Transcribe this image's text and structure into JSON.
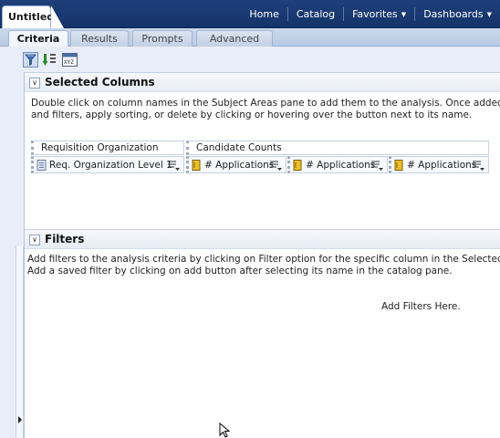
{
  "document_tab": {
    "title": "Untitled"
  },
  "nav": {
    "items": [
      {
        "label": "Home",
        "caret": false
      },
      {
        "label": "Catalog",
        "caret": false
      },
      {
        "label": "Favorites",
        "caret": true
      },
      {
        "label": "Dashboards",
        "caret": true
      }
    ]
  },
  "tabs": [
    {
      "label": "Criteria",
      "active": true
    },
    {
      "label": "Results",
      "active": false
    },
    {
      "label": "Prompts",
      "active": false
    },
    {
      "label": "Advanced",
      "active": false
    }
  ],
  "toolbar": {
    "buttons": [
      {
        "icon": "filter-icon",
        "active": true
      },
      {
        "icon": "sort-icon",
        "active": false
      },
      {
        "icon": "column-properties-icon",
        "active": false
      }
    ]
  },
  "selected_columns": {
    "title": "Selected Columns",
    "description_line1": "Double click on column names in the Subject Areas pane to add them to the analysis. Once added, drag-and-drop",
    "description_line2": "and filters, apply sorting, or delete by clicking or hovering over the button next to its name.",
    "groups": [
      {
        "header": "Requisition Organization",
        "columns": [
          {
            "label": "Req. Organization Level 1",
            "icon": "attribute-icon"
          }
        ]
      },
      {
        "header": "Candidate Counts",
        "columns": [
          {
            "label": "# Applications",
            "icon": "measure-icon"
          },
          {
            "label": "# Applications",
            "icon": "measure-icon"
          },
          {
            "label": "# Applications",
            "icon": "measure-icon"
          }
        ]
      }
    ]
  },
  "filters": {
    "title": "Filters",
    "description_line1": "Add filters to the analysis criteria by clicking on Filter option for the specific column in the Selected Columns",
    "description_line2": "Add a saved filter by clicking on add button after selecting its name in the catalog pane.",
    "placeholder": "Add Filters Here."
  },
  "colors": {
    "nav_bar": "#1e3f7a",
    "panel_bg": "#e8eef7",
    "accent": "#f0c020"
  }
}
